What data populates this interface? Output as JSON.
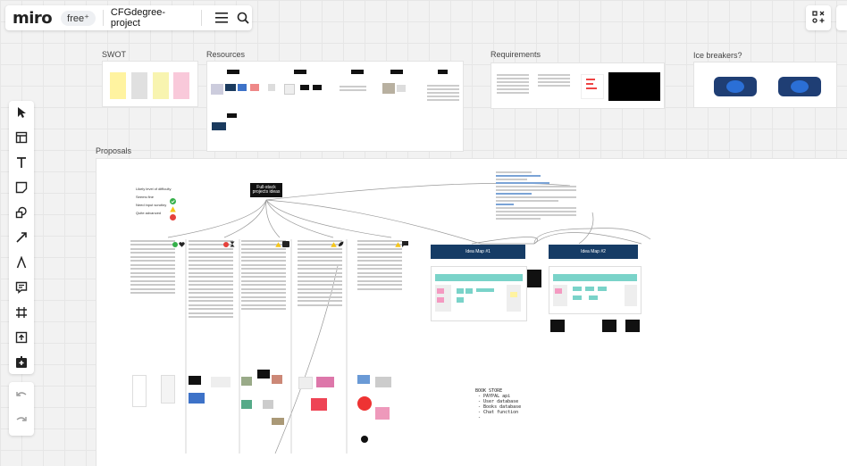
{
  "topbar": {
    "logo": "miro",
    "plan_badge": "free⁺",
    "project_name": "CFGdegree-project",
    "menu_icon": "hamburger-icon",
    "search_icon": "search-icon"
  },
  "frames": {
    "swot": "SWOT",
    "resources": "Resources",
    "requirements": "Requirements",
    "icebreakers": "Ice breakers?",
    "proposals": "Proposals"
  },
  "proposals": {
    "center_node": "Full-stack projects ideas",
    "legend_title": "Likely level of difficulty",
    "legend": [
      "Seems fine",
      "Need input scrutiny",
      "Quite advanced"
    ],
    "idea_map_1": "Idea Map #1",
    "idea_map_2": "Idea Map #2",
    "bookstore": "BOOK STORE\n - PAYPAL api\n - User database\n - Books database\n - Chat function\n -"
  },
  "colors": {
    "accent_navy": "#163c66",
    "sticky_teal": "#7ad3c9",
    "sticky_pink": "#f49ac1",
    "sticky_yellow": "#fff3a0",
    "check_green": "#35b04a",
    "warn_yellow": "#f5c518",
    "stop_red": "#e5413b"
  }
}
